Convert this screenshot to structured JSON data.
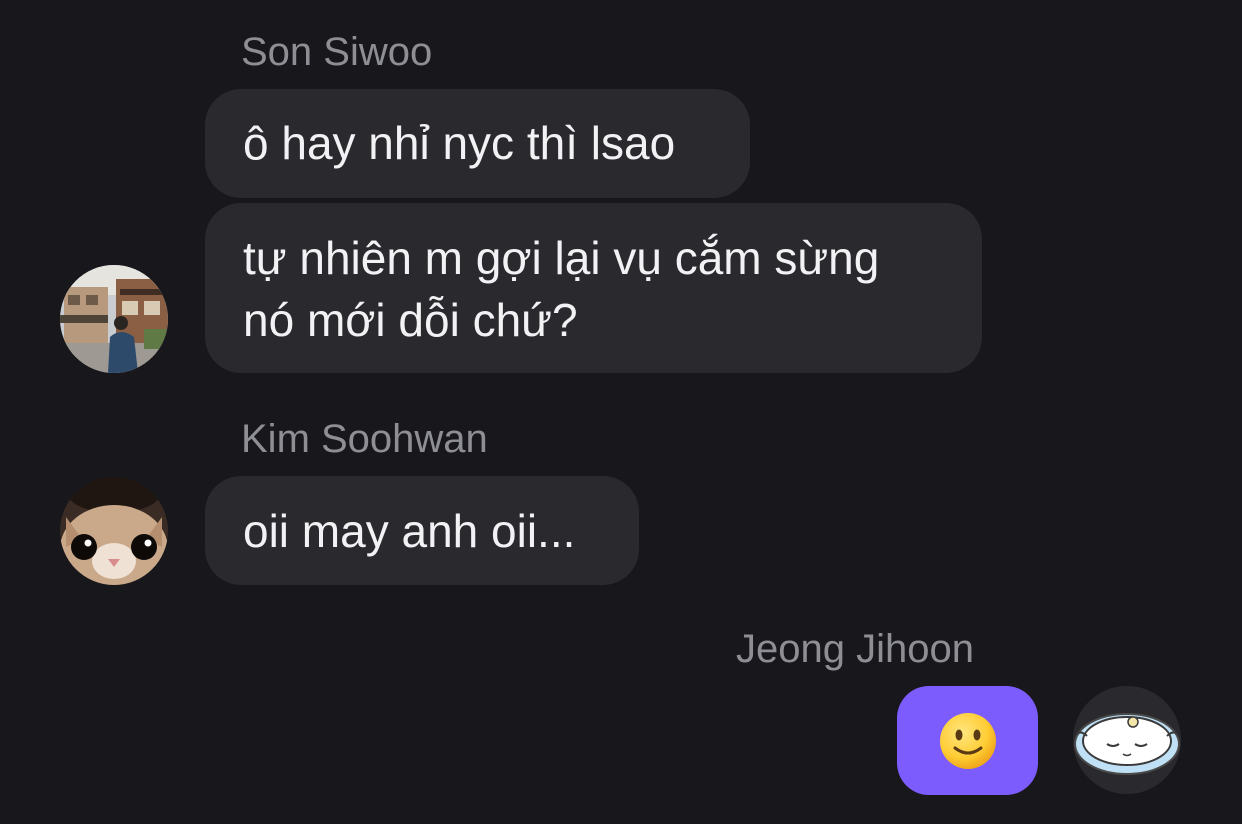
{
  "messages": [
    {
      "sender": "Son Siwoo",
      "avatar_icon": "profile-photo-street-icon",
      "bubbles": [
        {
          "lines": [
            "ô hay nhỉ nyc thì lsao"
          ]
        },
        {
          "lines": [
            "tự nhiên m gợi lại vụ cắm sừng",
            "nó mới dỗi chứ?"
          ]
        }
      ]
    },
    {
      "sender": "Kim Soohwan",
      "avatar_icon": "profile-photo-cat-icon",
      "bubbles": [
        {
          "lines": [
            "oii may anh oii..."
          ]
        }
      ]
    },
    {
      "sender": "Jeong Jihoon",
      "avatar_icon": "profile-sticker-seal-icon",
      "bubbles": [
        {
          "emoji": "slightly-smiling-face-icon"
        }
      ]
    }
  ],
  "colors": {
    "background": "#18181c",
    "incoming_bubble": "#2a2a2e",
    "outgoing_bubble": "#7c5cfc",
    "sender_name": "#8e8e95",
    "message_text": "#f2f2f4"
  }
}
